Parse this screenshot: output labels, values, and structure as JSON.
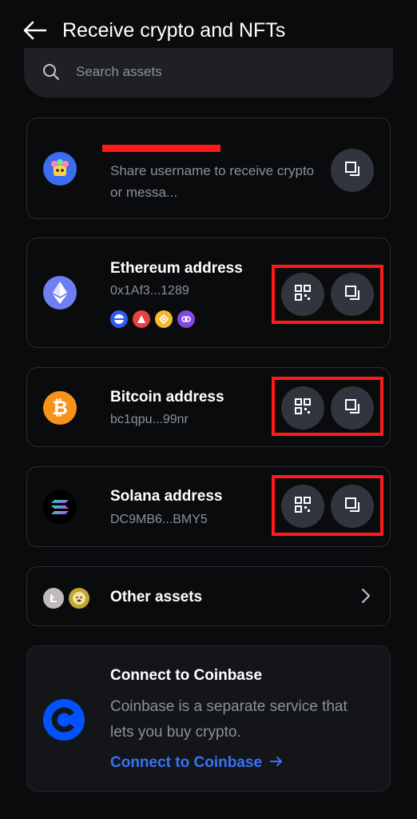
{
  "header": {
    "title": "Receive crypto and NFTs"
  },
  "search": {
    "placeholder": "Search assets"
  },
  "ens": {
    "description": "Share username to receive crypto or messa..."
  },
  "addresses": [
    {
      "label": "Ethereum address",
      "value": "0x1Af3...1289"
    },
    {
      "label": "Bitcoin address",
      "value": "bc1qpu...99nr"
    },
    {
      "label": "Solana address",
      "value": "DC9MB6...BMY5"
    }
  ],
  "other": {
    "label": "Other assets"
  },
  "coinbase": {
    "title": "Connect to Coinbase",
    "description": "Coinbase is a separate service that lets you buy crypto.",
    "link": "Connect to Coinbase"
  },
  "colors": {
    "background": "#0a0b0d",
    "accent": "#3773f5",
    "highlight": "#ff1a1a"
  }
}
